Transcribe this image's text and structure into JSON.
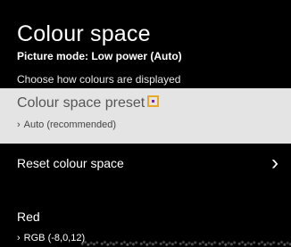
{
  "header": {
    "title": "Colour space",
    "subtitle": "Picture mode: Low power (Auto)",
    "description": "Choose how colours are displayed"
  },
  "menu": {
    "items": [
      {
        "label": "Colour space preset",
        "value": "Auto (recommended)",
        "focused": true,
        "chevron_icon": "chevron-right-small"
      },
      {
        "label": "Reset colour space",
        "arrow_icon": "chevron-right-large",
        "arrow_glyph": "›"
      },
      {
        "label": "Red",
        "value": "RGB (-8,0,12)",
        "chevron_icon": "chevron-right-small"
      }
    ],
    "value_chevron_glyph": "›"
  },
  "colors": {
    "background": "#000000",
    "selected_row": "#e4e4e4",
    "focus_outline": "#e7a92a",
    "focus_dot": "#6a2ca0"
  }
}
